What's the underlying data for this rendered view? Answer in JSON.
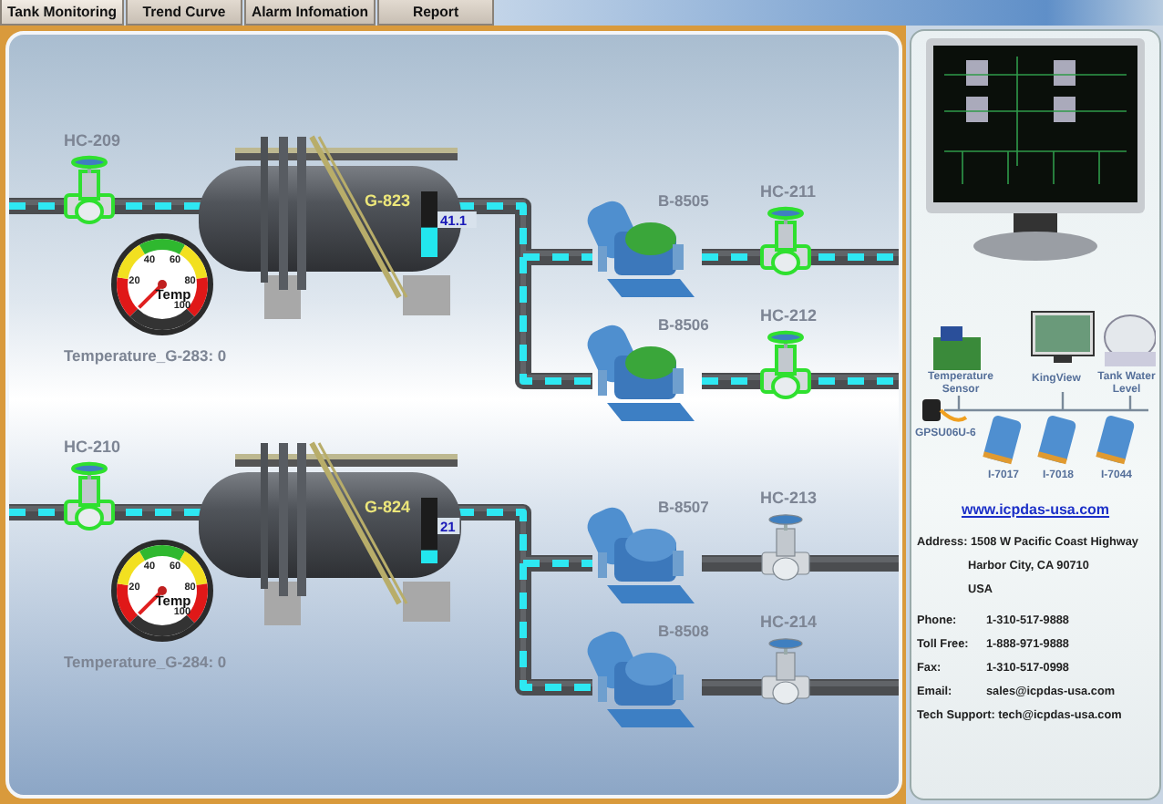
{
  "tabs": [
    {
      "label": "Tank Monitoring",
      "selected": true
    },
    {
      "label": "Trend Curve",
      "selected": false
    },
    {
      "label": "Alarm Infomation",
      "selected": false
    },
    {
      "label": "Report",
      "selected": false
    }
  ],
  "units": [
    {
      "inlet_valve": {
        "label": "HC-209",
        "open": true
      },
      "tank": {
        "label": "G-823",
        "reading": "41.1",
        "level": 0.45
      },
      "gauge": {
        "label": "Temp",
        "ticks": [
          "20",
          "40",
          "60",
          "80",
          "100"
        ]
      },
      "temperature": {
        "label": "Temperature_G-283:",
        "value": "0"
      },
      "lines": [
        {
          "pump": {
            "label": "B-8505",
            "running": true
          },
          "valve": {
            "label": "HC-211",
            "open": true
          }
        },
        {
          "pump": {
            "label": "B-8506",
            "running": true
          },
          "valve": {
            "label": "HC-212",
            "open": true
          }
        }
      ]
    },
    {
      "inlet_valve": {
        "label": "HC-210",
        "open": true
      },
      "tank": {
        "label": "G-824",
        "reading": "21",
        "level": 0.2
      },
      "gauge": {
        "label": "Temp",
        "ticks": [
          "20",
          "40",
          "60",
          "80",
          "100"
        ]
      },
      "temperature": {
        "label": "Temperature_G-284:",
        "value": "0"
      },
      "lines": [
        {
          "pump": {
            "label": "B-8507",
            "running": false
          },
          "valve": {
            "label": "HC-213",
            "open": false
          }
        },
        {
          "pump": {
            "label": "B-8508",
            "running": false
          },
          "valve": {
            "label": "HC-214",
            "open": false
          }
        }
      ]
    }
  ],
  "sidebar": {
    "devices": {
      "sensor": "Temperature Sensor",
      "software": "KingView",
      "level": "Tank Water Level",
      "power": "GPSU06U-6",
      "modules": [
        "I-7017",
        "I-7018",
        "I-7044"
      ]
    },
    "link": "www.icpdas-usa.com",
    "address": {
      "label": "Address:",
      "lines": [
        "1508 W Pacific Coast Highway",
        "Harbor City, CA 90710",
        "USA"
      ]
    },
    "contacts": [
      {
        "label": "Phone:",
        "value": "1-310-517-9888"
      },
      {
        "label": "Toll Free:",
        "value": "1-888-971-9888"
      },
      {
        "label": "Fax:",
        "value": "1-310-517-0998"
      },
      {
        "label": "Email:",
        "value": "sales@icpdas-usa.com"
      }
    ],
    "support": {
      "label": "Tech Support:",
      "value": "tech@icpdas-usa.com"
    }
  }
}
